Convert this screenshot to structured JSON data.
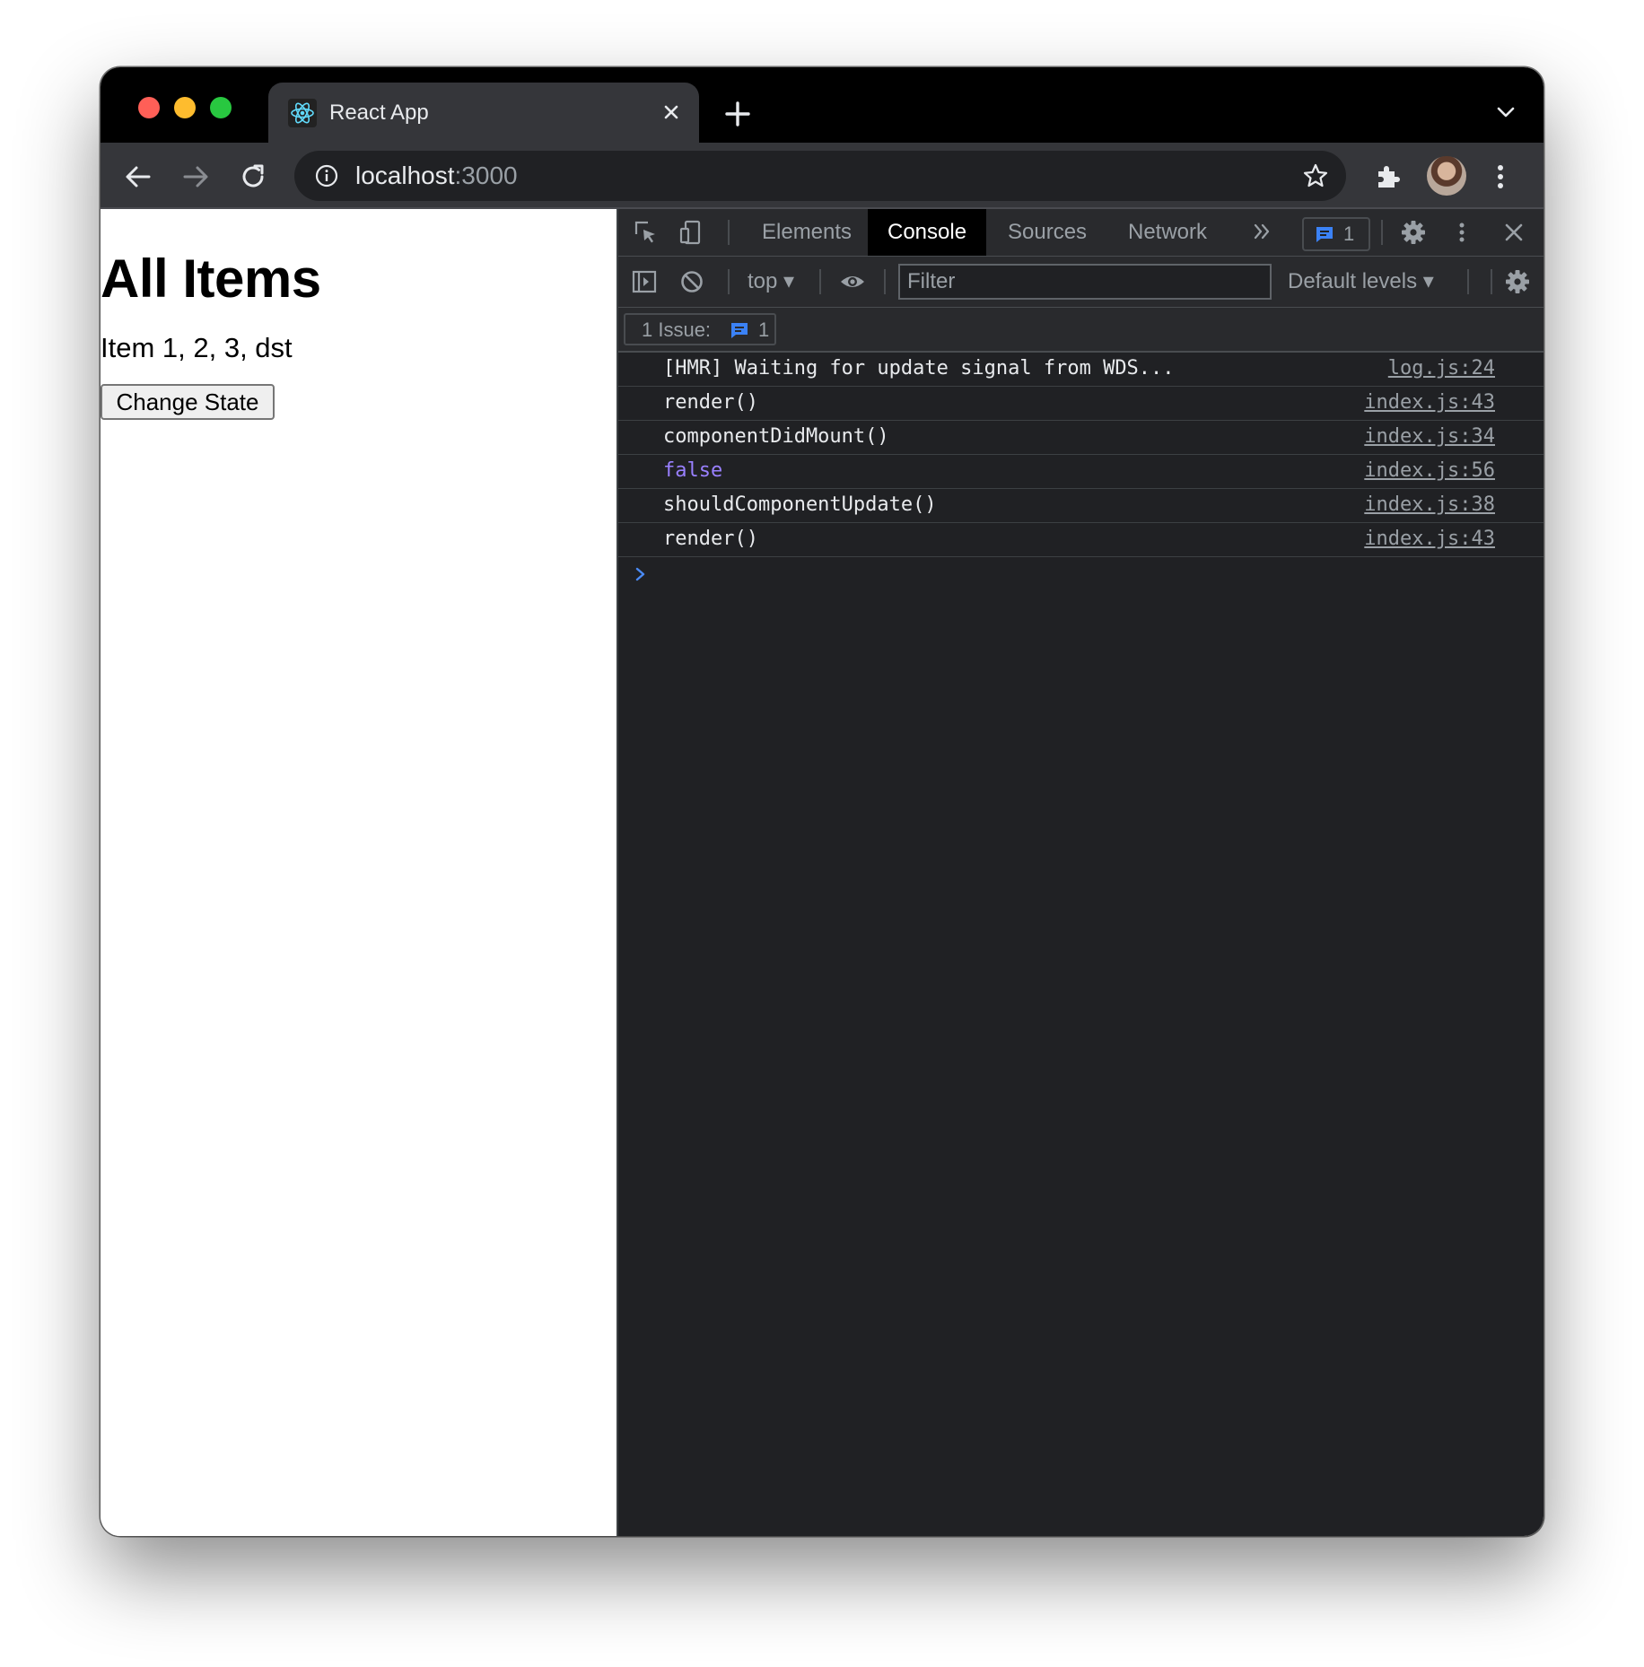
{
  "browser": {
    "tab": {
      "title": "React App"
    },
    "address": {
      "host": "localhost",
      "port": ":3000"
    }
  },
  "page": {
    "heading": "All Items",
    "items_text": "Item 1, 2, 3, dst",
    "button_label": "Change State"
  },
  "devtools": {
    "tabs": [
      {
        "label": "Elements"
      },
      {
        "label": "Console",
        "active": true
      },
      {
        "label": "Sources"
      },
      {
        "label": "Network"
      }
    ],
    "issue_badge_count": "1",
    "console_toolbar": {
      "context": "top",
      "filter_placeholder": "Filter",
      "levels": "Default levels"
    },
    "issues_bar": {
      "label": "1 Issue:",
      "count": "1"
    },
    "logs": [
      {
        "message": "[HMR] Waiting for update signal from WDS...",
        "source": "log.js:24"
      },
      {
        "message": "render()",
        "source": "index.js:43"
      },
      {
        "message": "componentDidMount()",
        "source": "index.js:34"
      },
      {
        "message": "false",
        "source": "index.js:56",
        "type": "boolean"
      },
      {
        "message": "shouldComponentUpdate()",
        "source": "index.js:38"
      },
      {
        "message": "render()",
        "source": "index.js:43"
      }
    ]
  },
  "colors": {
    "close_light": "#ff5f57",
    "minimize_light": "#febc2e",
    "zoom_light": "#28c840",
    "boolean_value": "#9980ff",
    "issue_blue": "#3b82f6"
  }
}
